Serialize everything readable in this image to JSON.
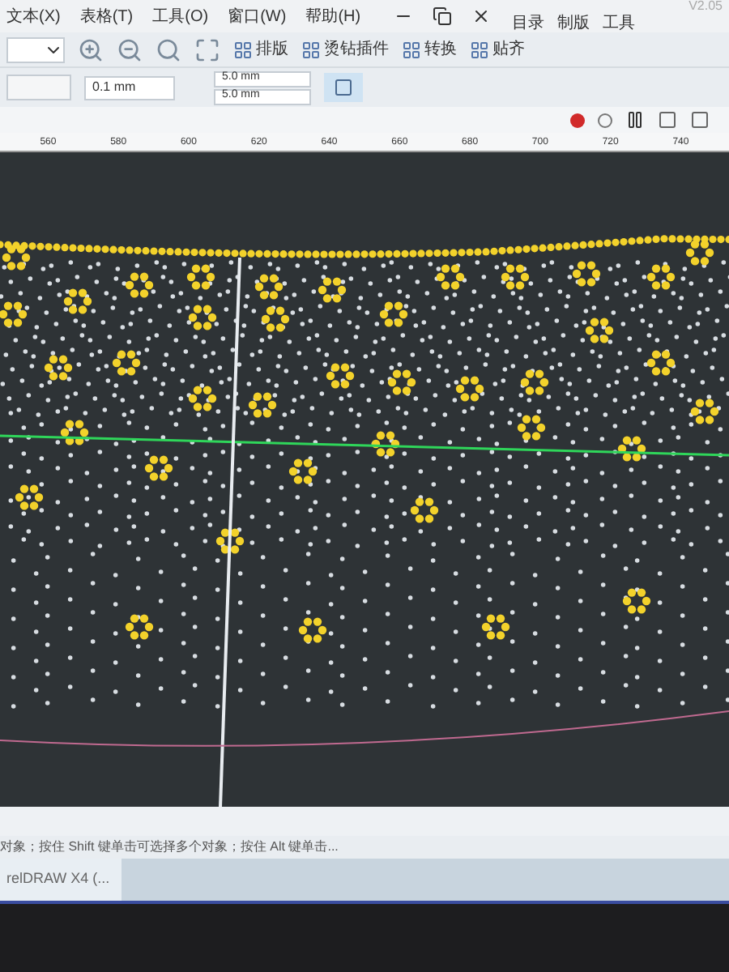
{
  "menu": [
    "文本(X)",
    "表格(T)",
    "工具(O)",
    "窗口(W)",
    "帮助(H)"
  ],
  "panel": {
    "version": "V2.05",
    "tabs": [
      "目录",
      "制版",
      "工具"
    ]
  },
  "toolbar_buttons": [
    "排版",
    "烫钻插件",
    "转换",
    "贴齐"
  ],
  "property_bar": {
    "nudge": "0.1 mm",
    "offset_x": "5.0 mm",
    "offset_y": "5.0 mm"
  },
  "ruler_labels": [
    "560",
    "580",
    "600",
    "620",
    "640",
    "660",
    "680",
    "700",
    "720",
    "740"
  ],
  "status_text": "对象；按住 Shift 键单击可选择多个对象；按住 Alt 键单击...",
  "taskbar_item": "relDRAW X4 (..."
}
